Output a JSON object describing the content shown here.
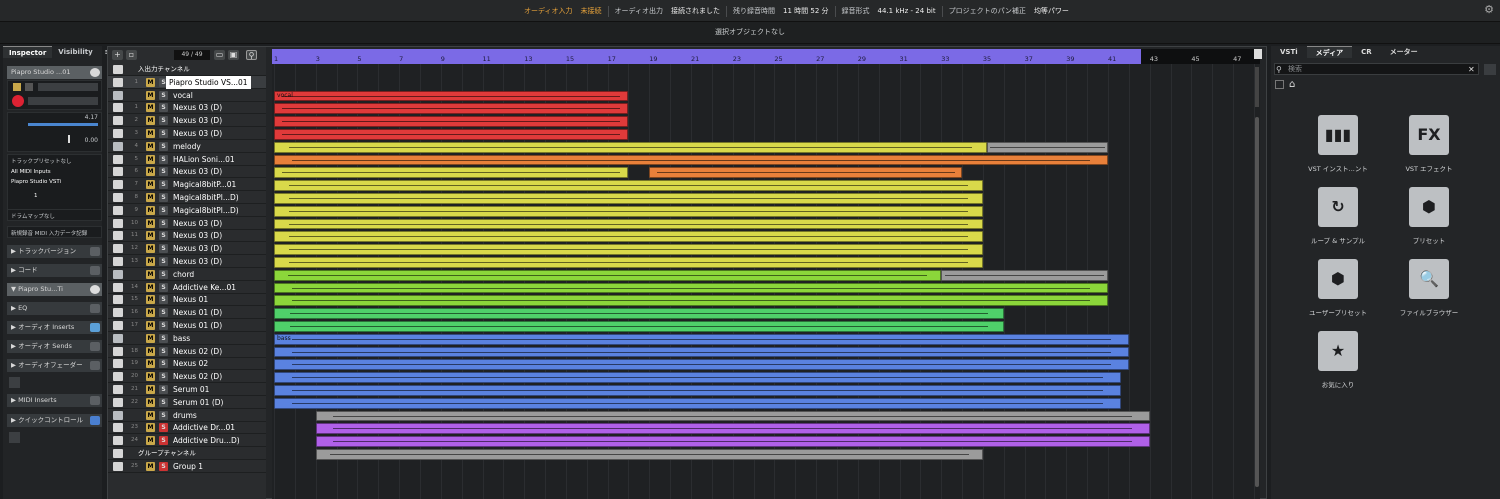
{
  "status": {
    "audio_in": "オーディオ入力",
    "audio_in_state": "未接続",
    "audio_out": "オーディオ出力",
    "audio_out_state": "接続されました",
    "rec_time_label": "残り録音時間",
    "rec_time": "11 時間 52 分",
    "rec_format_label": "録音形式",
    "rec_format": "44.1 kHz - 24 bit",
    "pan_label": "プロジェクトのパン補正",
    "pan_value": "均等パワー"
  },
  "info": "選択オブジェクトなし",
  "inspector": {
    "tab_inspector": "Inspector",
    "tab_visibility": "Visibility",
    "track_title": "Piapro Studio ...01",
    "volume": "4.17",
    "pan": "0.00",
    "track_preset": "トラックプリセットなし",
    "midi_in": "All MIDI Inputs",
    "midi_out": "Piapro Studio VSTi",
    "channel": "1",
    "drum_map": "ドラムマップなし",
    "midi_record": "新規録音 MIDI 入力データ記録",
    "sections": [
      "トラックバージョン",
      "コード",
      "Piapro Stu...Ti",
      "EQ",
      "オーディオ Inserts",
      "オーディオ Sends",
      "オーディオフェーダー",
      "MIDI Inserts",
      "クイックコントロール"
    ]
  },
  "toolbar": {
    "counter": "49 / 49"
  },
  "tracks": [
    {
      "num": "",
      "name": "入出力チャンネル",
      "kind": "io"
    },
    {
      "num": "1",
      "name": "Piapro Studio VS...01",
      "kind": "inst"
    },
    {
      "num": "",
      "name": "vocal",
      "kind": "folder"
    },
    {
      "num": "1",
      "name": "Nexus 03 (D)",
      "kind": "inst"
    },
    {
      "num": "2",
      "name": "Nexus 03 (D)",
      "kind": "inst"
    },
    {
      "num": "3",
      "name": "Nexus 03 (D)",
      "kind": "inst"
    },
    {
      "num": "4",
      "name": "melody",
      "kind": "folder"
    },
    {
      "num": "5",
      "name": "HALion Soni...01",
      "kind": "inst"
    },
    {
      "num": "6",
      "name": "Nexus 03 (D)",
      "kind": "inst"
    },
    {
      "num": "7",
      "name": "Magical8bitP...01",
      "kind": "inst"
    },
    {
      "num": "8",
      "name": "Magical8bitPl...D)",
      "kind": "inst"
    },
    {
      "num": "9",
      "name": "Magical8bitPl...D)",
      "kind": "inst"
    },
    {
      "num": "10",
      "name": "Nexus 03 (D)",
      "kind": "inst"
    },
    {
      "num": "11",
      "name": "Nexus 03 (D)",
      "kind": "inst"
    },
    {
      "num": "12",
      "name": "Nexus 03 (D)",
      "kind": "inst"
    },
    {
      "num": "13",
      "name": "Nexus 03 (D)",
      "kind": "inst"
    },
    {
      "num": "",
      "name": "chord",
      "kind": "folder"
    },
    {
      "num": "14",
      "name": "Addictive Ke...01",
      "kind": "inst"
    },
    {
      "num": "15",
      "name": "Nexus 01",
      "kind": "inst"
    },
    {
      "num": "16",
      "name": "Nexus 01 (D)",
      "kind": "inst"
    },
    {
      "num": "17",
      "name": "Nexus 01 (D)",
      "kind": "inst"
    },
    {
      "num": "",
      "name": "bass",
      "kind": "folder"
    },
    {
      "num": "18",
      "name": "Nexus 02 (D)",
      "kind": "inst"
    },
    {
      "num": "19",
      "name": "Nexus 02",
      "kind": "inst"
    },
    {
      "num": "20",
      "name": "Nexus 02 (D)",
      "kind": "inst"
    },
    {
      "num": "21",
      "name": "Serum 01",
      "kind": "inst"
    },
    {
      "num": "22",
      "name": "Serum 01 (D)",
      "kind": "inst"
    },
    {
      "num": "",
      "name": "drums",
      "kind": "folder"
    },
    {
      "num": "23",
      "name": "Addictive Dr...01",
      "kind": "inst"
    },
    {
      "num": "24",
      "name": "Addictive Dru...D)",
      "kind": "inst"
    },
    {
      "num": "",
      "name": "グループチャンネル",
      "kind": "group"
    },
    {
      "num": "25",
      "name": "Group 1",
      "kind": "inst"
    }
  ],
  "ruler": [
    "1",
    "3",
    "5",
    "7",
    "9",
    "11",
    "13",
    "15",
    "17",
    "19",
    "21",
    "23",
    "25",
    "27",
    "29",
    "31",
    "33",
    "35",
    "37",
    "39",
    "41",
    "43",
    "45",
    "47"
  ],
  "part_labels": {
    "vocal": "vocal",
    "bass": "bass"
  },
  "right": {
    "tabs": [
      "VSTi",
      "メディア",
      "CR",
      "メーター"
    ],
    "search_placeholder": "検索",
    "items": [
      {
        "label": "VST インスト...ント",
        "glyph": "▮▮▮"
      },
      {
        "label": "VST エフェクト",
        "glyph": "FX"
      },
      {
        "label": "ループ & サンプル",
        "glyph": "↻"
      },
      {
        "label": "プリセット",
        "glyph": "⬢"
      },
      {
        "label": "ユーザープリセット",
        "glyph": "⬢"
      },
      {
        "label": "ファイルブラウザー",
        "glyph": "🔍"
      },
      {
        "label": "お気に入り",
        "glyph": "★"
      }
    ]
  },
  "colors": {
    "vocal": "#e03a3a",
    "melody": "#d9d94a",
    "orange": "#e8803a",
    "chord": "#8bd63a",
    "green": "#4fd06a",
    "bass": "#5a82e0",
    "drums": "#b060e8",
    "gray": "#9b9b9b",
    "ruler": "#7b6ae6"
  }
}
